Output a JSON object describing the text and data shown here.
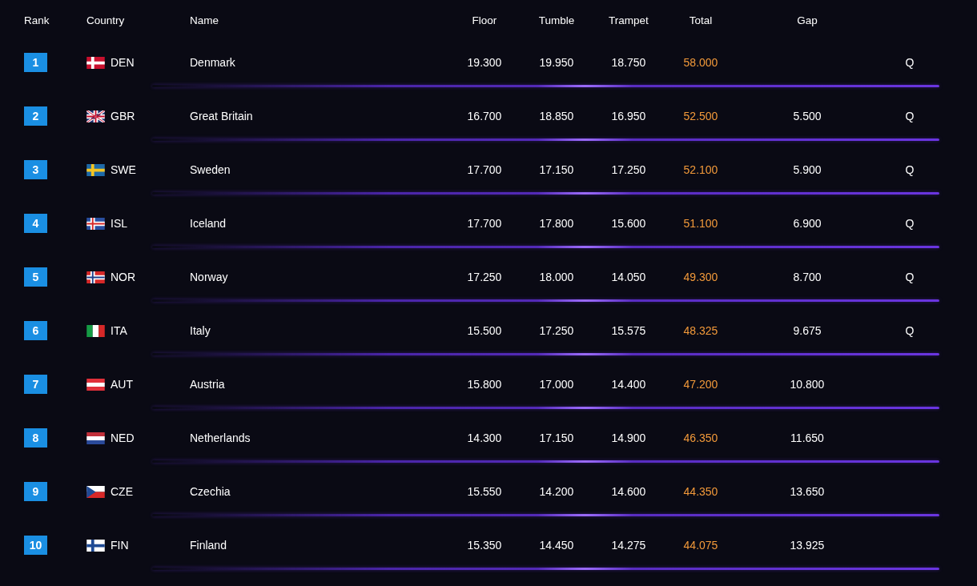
{
  "table": {
    "columns": [
      "Rank",
      "Country",
      "Name",
      "Floor",
      "Tumble",
      "Trampet",
      "Total",
      "Gap"
    ],
    "rows": [
      {
        "rank": "1",
        "code": "DEN",
        "flag": {
          "kind": "cross",
          "parts": [
            {
              "color": "#c8102e"
            },
            {
              "color": "#ffffff"
            }
          ]
        },
        "name": "Denmark",
        "floor": "19.300",
        "tumble": "19.950",
        "trampet": "18.750",
        "total": "58.000",
        "q": "Q"
      },
      {
        "rank": "2",
        "code": "GBR",
        "flag": {
          "kind": "union",
          "parts": [
            {
              "color": "#1f2f6e"
            },
            {
              "color": "#ffffff"
            },
            {
              "color": "#c8102e"
            }
          ]
        },
        "name": "Great Britain",
        "floor": "16.700",
        "tumble": "18.850",
        "trampet": "16.950",
        "total": "52.500",
        "gap": "5.500",
        "q": "Q"
      },
      {
        "rank": "3",
        "code": "SWE",
        "flag": {
          "kind": "cross",
          "parts": [
            {
              "color": "#1e6aa8"
            },
            {
              "color": "#f4c522"
            }
          ]
        },
        "name": "Sweden",
        "floor": "17.700",
        "tumble": "17.150",
        "trampet": "17.250",
        "total": "52.100",
        "gap": "5.900",
        "q": "Q"
      },
      {
        "rank": "4",
        "code": "ISL",
        "flag": {
          "kind": "cross",
          "parts": [
            {
              "color": "#2a4fa0"
            },
            {
              "color": "#ffffff"
            },
            {
              "color": "#d72828"
            }
          ]
        },
        "name": "Iceland",
        "floor": "17.700",
        "tumble": "17.800",
        "trampet": "15.600",
        "total": "51.100",
        "gap": "6.900",
        "q": "Q"
      },
      {
        "rank": "5",
        "code": "NOR",
        "flag": {
          "kind": "cross",
          "parts": [
            {
              "color": "#d72828"
            },
            {
              "color": "#ffffff"
            },
            {
              "color": "#1f3f8a"
            }
          ]
        },
        "name": "Norway",
        "floor": "17.250",
        "tumble": "18.000",
        "trampet": "14.050",
        "total": "49.300",
        "gap": "8.700",
        "q": "Q"
      },
      {
        "rank": "6",
        "code": "ITA",
        "flag": {
          "kind": "vertical",
          "parts": [
            {
              "color": "#169b45"
            },
            {
              "color": "#ffffff"
            },
            {
              "color": "#d72828"
            }
          ]
        },
        "name": "Italy",
        "floor": "15.500",
        "tumble": "17.250",
        "trampet": "15.575",
        "total": "48.325",
        "gap": "9.675",
        "q": "Q"
      },
      {
        "rank": "7",
        "code": "AUT",
        "flag": {
          "kind": "horizontal",
          "parts": [
            {
              "color": "#e0303a"
            },
            {
              "color": "#ffffff"
            },
            {
              "color": "#e0303a"
            }
          ]
        },
        "name": "Austria",
        "floor": "15.800",
        "tumble": "17.000",
        "trampet": "14.400",
        "total": "47.200",
        "gap": "10.800"
      },
      {
        "rank": "8",
        "code": "NED",
        "flag": {
          "kind": "horizontal",
          "parts": [
            {
              "color": "#c2303a"
            },
            {
              "color": "#ffffff"
            },
            {
              "color": "#2a4a9a"
            }
          ]
        },
        "name": "Netherlands",
        "floor": "14.300",
        "tumble": "17.150",
        "trampet": "14.900",
        "total": "46.350",
        "gap": "11.650"
      },
      {
        "rank": "9",
        "code": "CZE",
        "flag": {
          "kind": "chevron",
          "parts": [
            {
              "color": "#ffffff"
            },
            {
              "color": "#d72828"
            },
            {
              "color": "#1f4a94"
            }
          ]
        },
        "name": "Czechia",
        "floor": "15.550",
        "tumble": "14.200",
        "trampet": "14.600",
        "total": "44.350",
        "gap": "13.650"
      },
      {
        "rank": "10",
        "code": "FIN",
        "flag": {
          "kind": "cross",
          "parts": [
            {
              "color": "#ffffff"
            },
            {
              "color": "#1f4a94"
            }
          ]
        },
        "name": "Finland",
        "floor": "15.350",
        "tumble": "14.450",
        "trampet": "14.275",
        "total": "44.075",
        "gap": "13.925"
      }
    ]
  }
}
